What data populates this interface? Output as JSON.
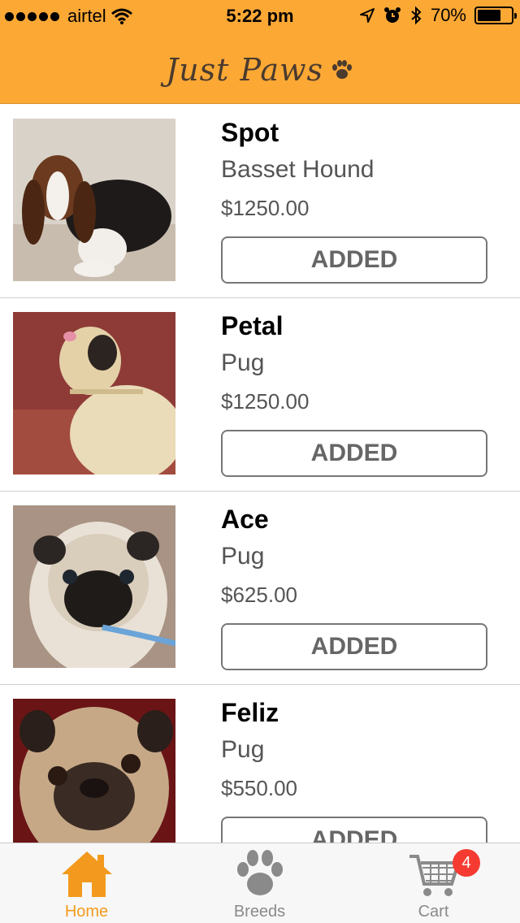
{
  "status_bar": {
    "carrier": "airtel",
    "time": "5:22 pm",
    "battery_percent": "70%",
    "battery_level": 0.7,
    "icons": [
      "signal-dots",
      "wifi-icon",
      "location-arrow-icon",
      "alarm-icon",
      "bluetooth-icon",
      "battery-icon"
    ]
  },
  "header": {
    "brand": "Just Paws"
  },
  "puppies": [
    {
      "name": "Spot",
      "breed": "Basset Hound",
      "price": "$1250.00",
      "button": "ADDED",
      "image": "basset-hound-puppy"
    },
    {
      "name": "Petal",
      "breed": "Pug",
      "price": "$1250.00",
      "button": "ADDED",
      "image": "pug-side-view"
    },
    {
      "name": "Ace",
      "breed": "Pug",
      "price": "$625.00",
      "button": "ADDED",
      "image": "pug-face-blue-collar"
    },
    {
      "name": "Feliz",
      "breed": "Pug",
      "price": "$550.00",
      "button": "ADDED",
      "image": "pug-face-close"
    }
  ],
  "tabbar": {
    "tabs": [
      {
        "label": "Home",
        "icon": "home-icon",
        "active": true
      },
      {
        "label": "Breeds",
        "icon": "paw-icon",
        "active": false
      },
      {
        "label": "Cart",
        "icon": "cart-icon",
        "active": false
      }
    ],
    "cart_badge": "4"
  },
  "colors": {
    "header_orange": "#fca835",
    "active_tab": "#f39a1e",
    "badge_red": "#f53b31"
  }
}
